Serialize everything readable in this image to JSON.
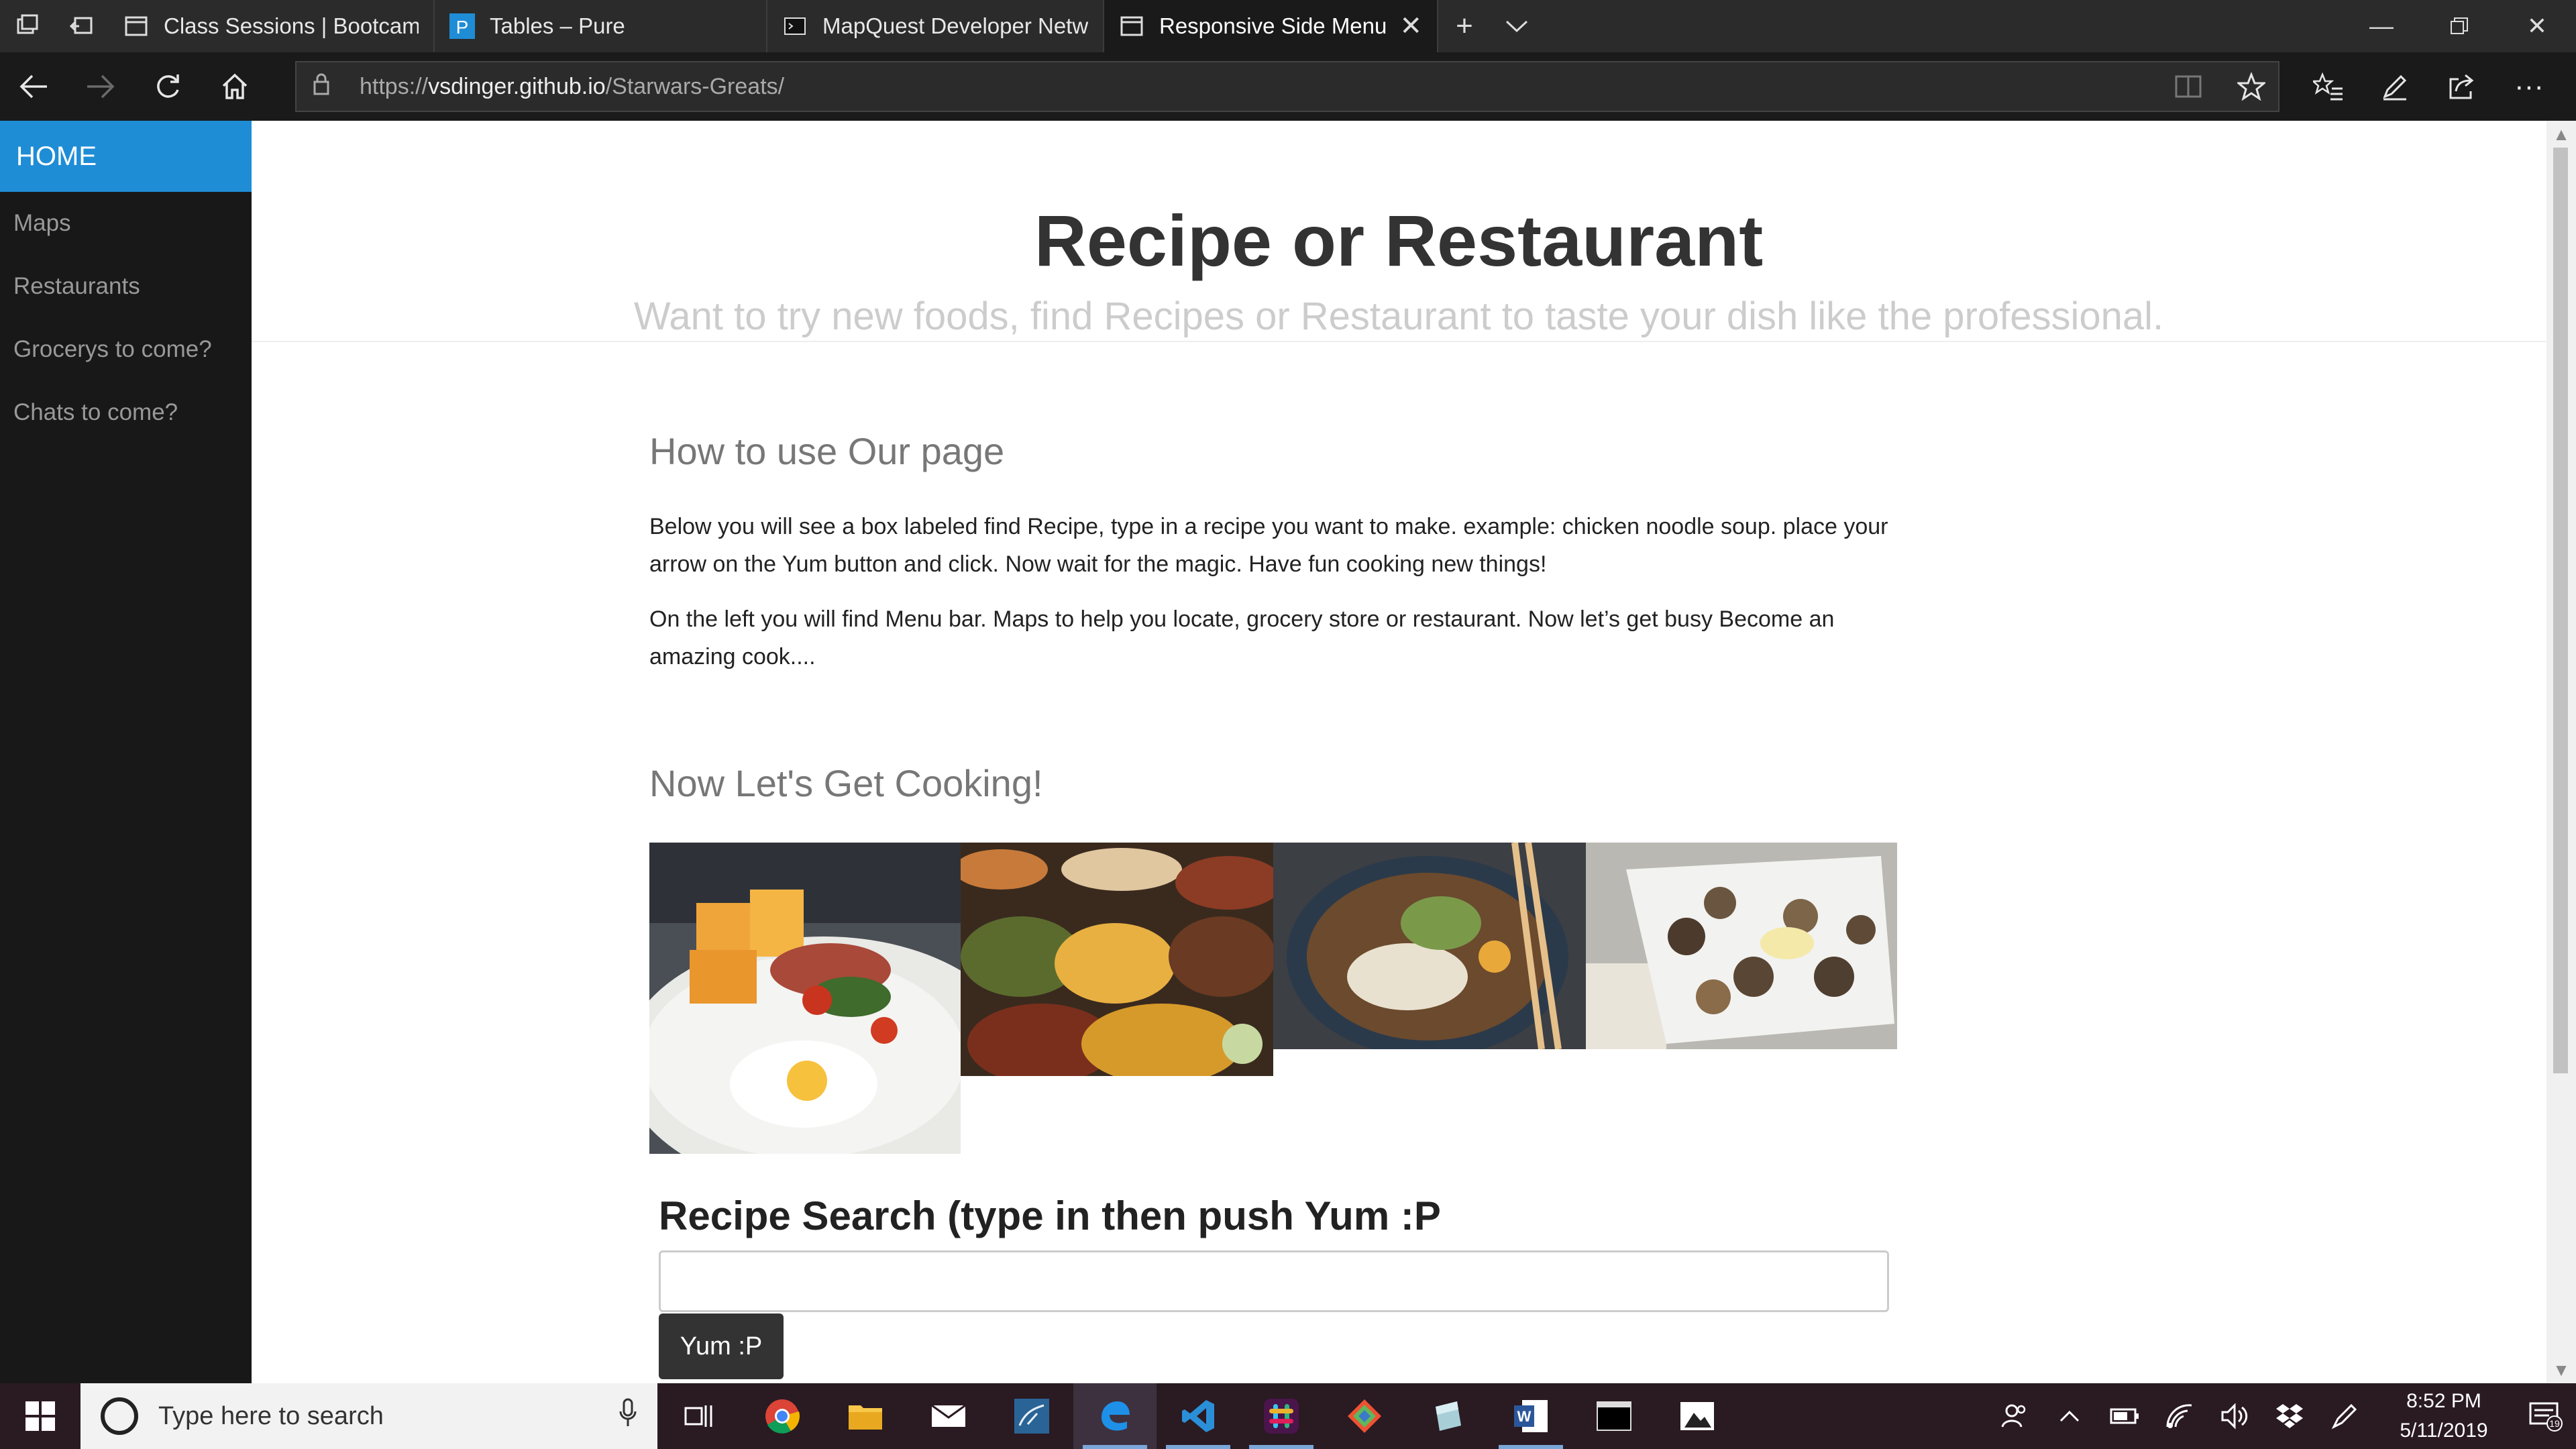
{
  "browser": {
    "tabs": [
      {
        "title": "Class Sessions | Bootcamp S"
      },
      {
        "title": "Tables – Pure"
      },
      {
        "title": "MapQuest Developer Netwo"
      },
      {
        "title": "Responsive Side Menu -"
      }
    ],
    "url": {
      "scheme": "https://",
      "host": "vsdinger.github.io",
      "path": "/Starwars-Greats/"
    }
  },
  "sidebar": {
    "items": [
      {
        "label": "HOME"
      },
      {
        "label": "Maps"
      },
      {
        "label": "Restaurants"
      },
      {
        "label": "Grocerys to come?"
      },
      {
        "label": "Chats to come?"
      }
    ]
  },
  "header": {
    "title": "Recipe or Restaurant",
    "subtitle": "Want to try new foods, find Recipes or Restaurant to taste your dish like the professional."
  },
  "content": {
    "how_heading": "How to use Our page",
    "paragraph1": "Below you will see a box labeled find Recipe, type in a recipe you want to make. example: chicken noodle soup. place your arrow on the Yum button and click. Now wait for the magic. Have fun cooking new things!",
    "paragraph2": "On the left you will find Menu bar. Maps to help you locate, grocery store or restaurant. Now let’s get busy Become an amazing cook....",
    "cooking_heading": "Now Let's Get Cooking!",
    "photos": [
      "breakfast-plate",
      "asian-feast",
      "ramen-bowl",
      "seafood-platter"
    ]
  },
  "search": {
    "title": "Recipe Search (type in then push Yum :P",
    "input_value": "",
    "button_label": "Yum :P"
  },
  "taskbar": {
    "search_placeholder": "Type here to search",
    "time": "8:52 PM",
    "date": "5/11/2019",
    "notification_count": "19"
  }
}
